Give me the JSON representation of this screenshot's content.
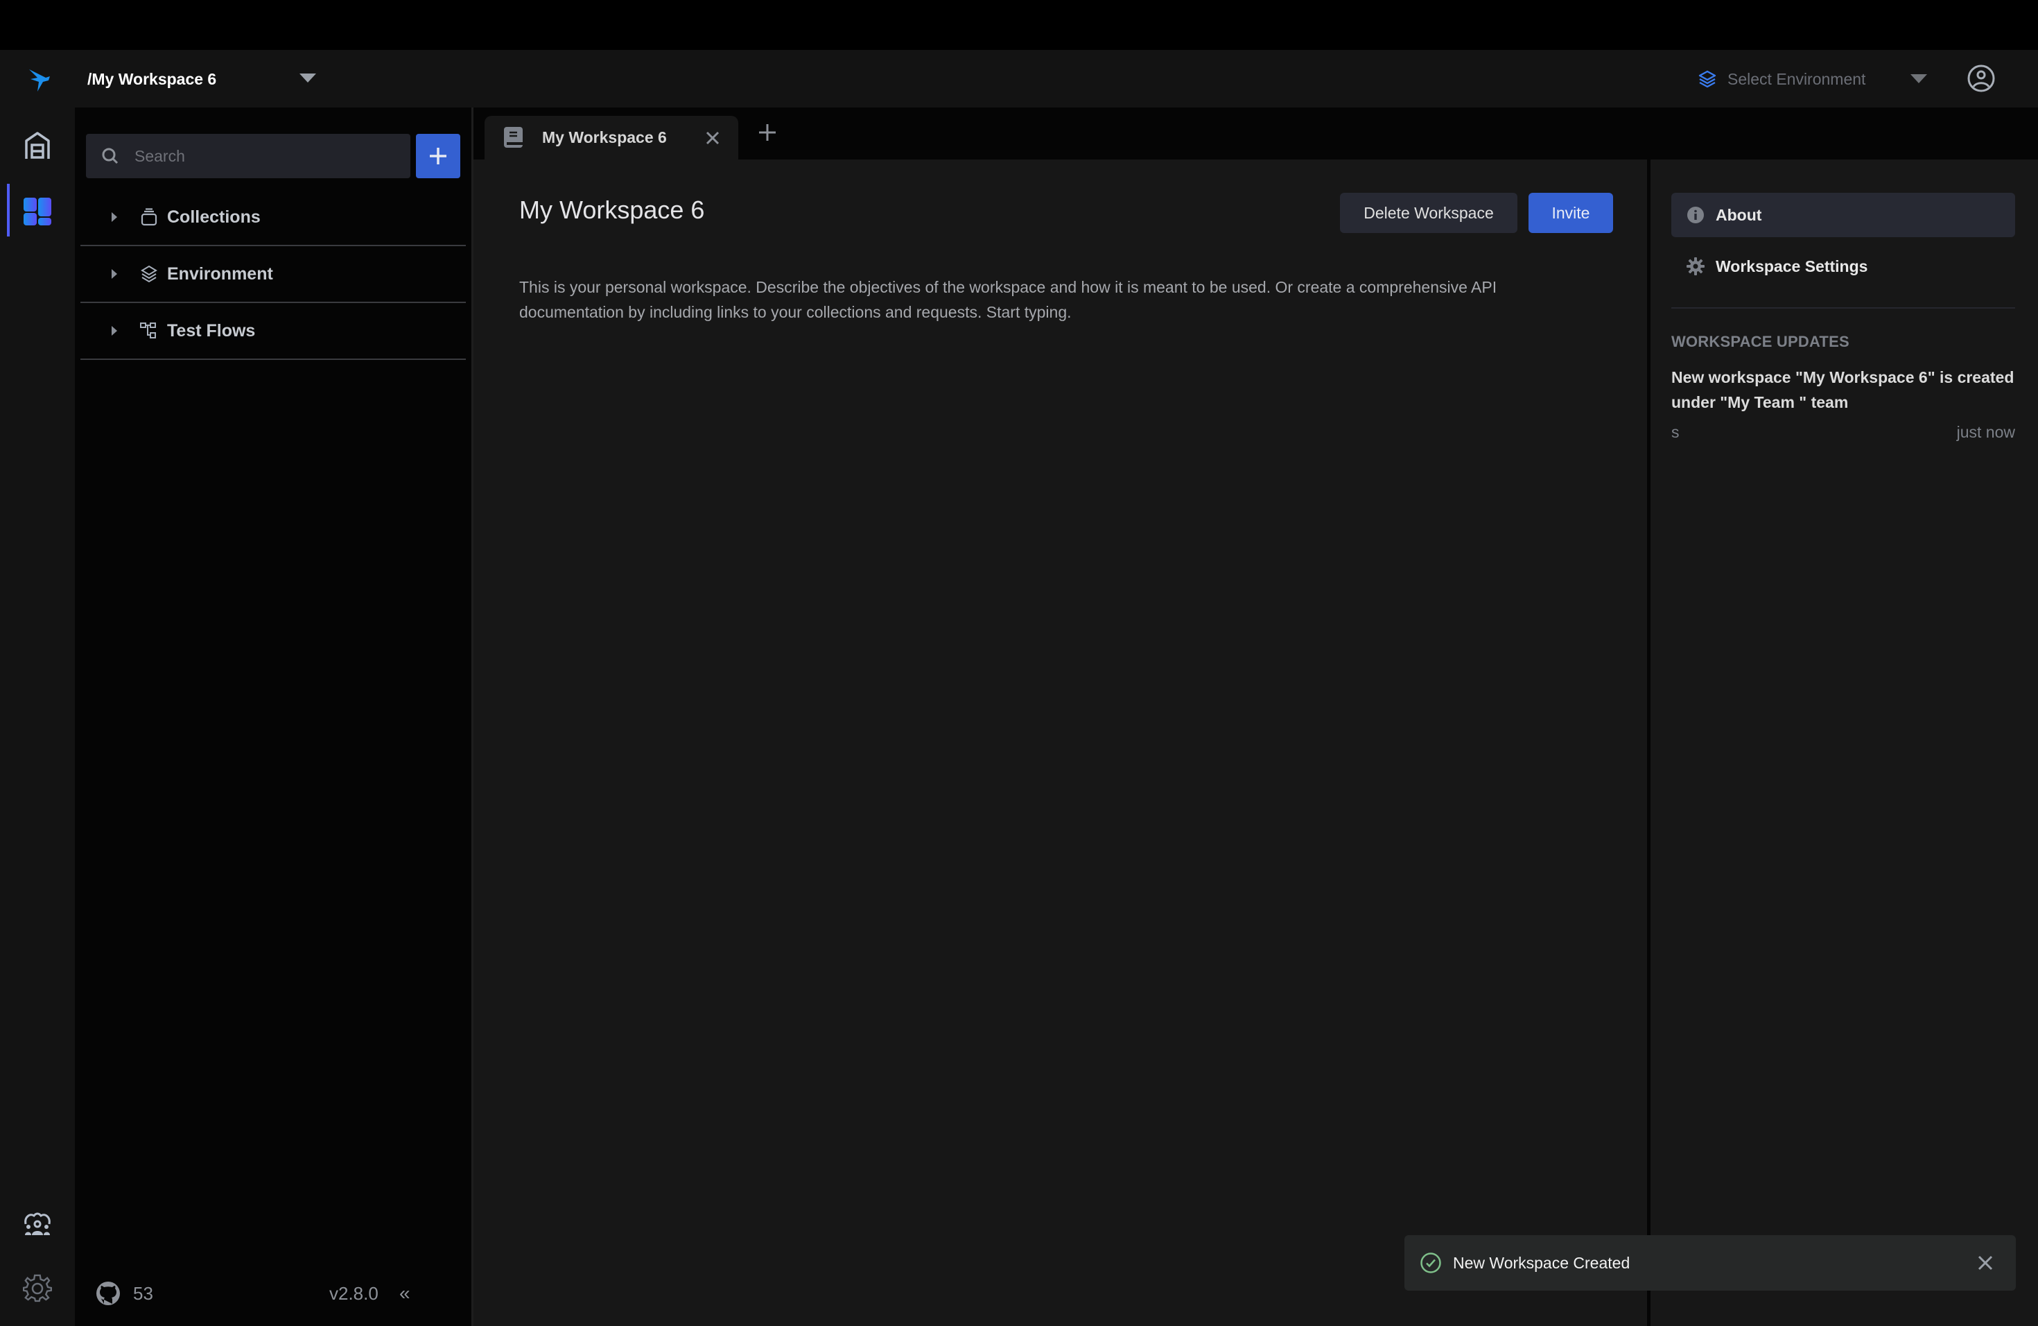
{
  "header": {
    "workspace_title": "/My Workspace 6",
    "environment_placeholder": "Select Environment"
  },
  "rail": {
    "items": [
      {
        "icon": "home-icon",
        "active": false
      },
      {
        "icon": "workspace-dashboard-icon",
        "active": true
      },
      {
        "icon": "team-icon",
        "active": false
      },
      {
        "icon": "settings-gear-icon",
        "active": false
      }
    ]
  },
  "sidebar": {
    "search_placeholder": "Search",
    "search_value": "",
    "items": [
      {
        "label": "Collections",
        "icon": "collections-icon"
      },
      {
        "label": "Environment",
        "icon": "layers-icon"
      },
      {
        "label": "Test Flows",
        "icon": "flow-icon"
      }
    ],
    "footer": {
      "github_stars": "53",
      "version": "v2.8.0",
      "collapse_glyph": "«"
    }
  },
  "tabs": [
    {
      "label": "My Workspace 6",
      "icon": "book-icon",
      "active": true
    }
  ],
  "main": {
    "title": "My Workspace 6",
    "delete_label": "Delete Workspace",
    "invite_label": "Invite",
    "description": "This is your personal workspace. Describe the objectives of the workspace and how it is meant to be used. Or create a comprehensive API documentation by including links to your collections and requests. Start typing."
  },
  "right_panel": {
    "items": [
      {
        "label": "About",
        "icon": "info-icon",
        "active": true
      },
      {
        "label": "Workspace Settings",
        "icon": "gear-icon",
        "active": false
      }
    ],
    "updates_heading": "WORKSPACE UPDATES",
    "updates": [
      {
        "text": "New workspace \"My Workspace 6\" is created under \"My Team \" team",
        "user": "s",
        "time": "just now"
      }
    ]
  },
  "toast": {
    "message": "New Workspace Created",
    "status": "success"
  },
  "colors": {
    "accent": "#3460d1",
    "active_indicator": "#4f5cf6",
    "success": "#7fc08a"
  }
}
